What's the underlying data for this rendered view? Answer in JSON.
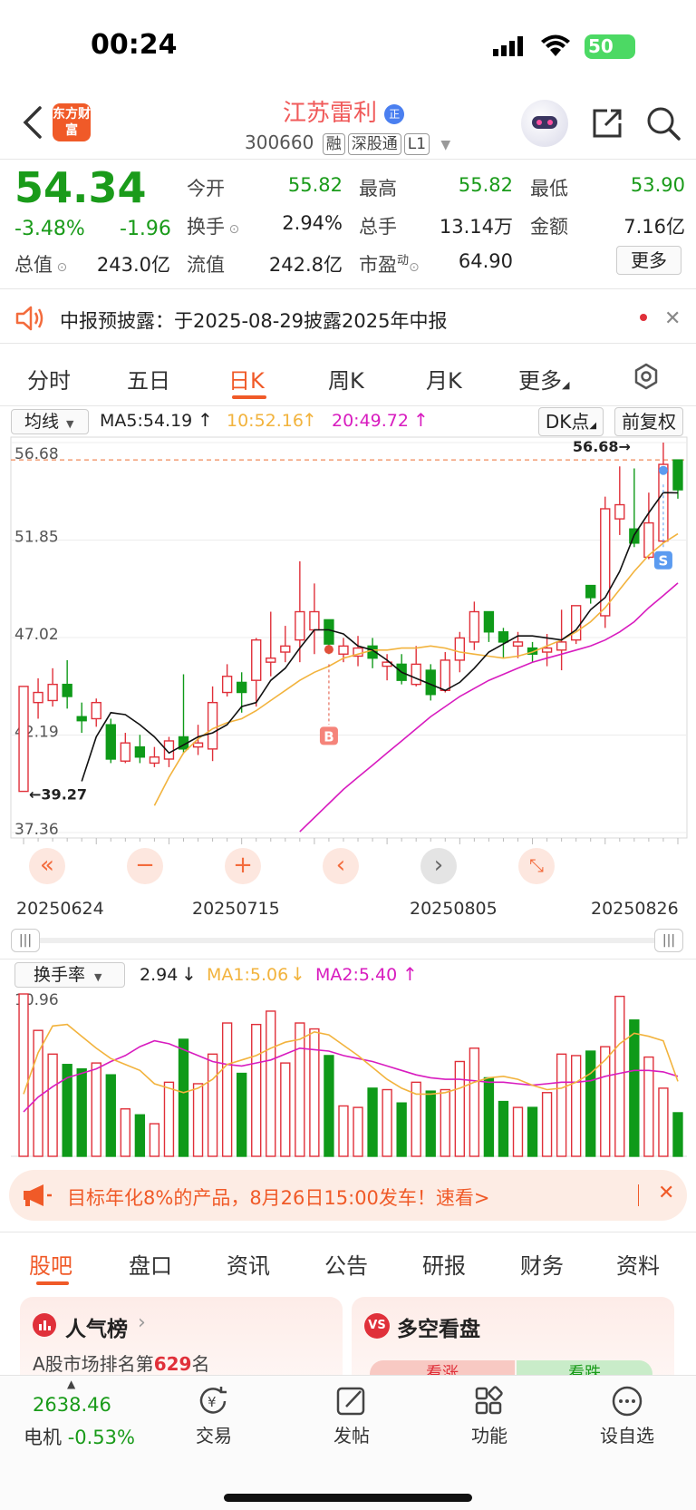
{
  "status_bar": {
    "time": "00:24",
    "battery": "50"
  },
  "header": {
    "logo": "东方财富",
    "title": "江苏雷利",
    "title_badge": "正",
    "code": "300660",
    "badges": [
      "融",
      "深股通",
      "L1"
    ]
  },
  "quote": {
    "price": "54.34",
    "change_pct": "-3.48%",
    "change": "-1.96",
    "rows": [
      [
        {
          "label": "今开",
          "value": "55.82",
          "color": "green"
        },
        {
          "label": "最高",
          "value": "55.82",
          "color": "green"
        },
        {
          "label": "最低",
          "value": "53.90",
          "color": "green"
        }
      ],
      [
        {
          "label": "换手",
          "value": "2.94%",
          "color": "dark"
        },
        {
          "label": "总手",
          "value": "13.14万",
          "color": "dark"
        },
        {
          "label": "金额",
          "value": "7.16亿",
          "color": "dark"
        }
      ]
    ],
    "total_value_label": "总值",
    "total_value": "243.0亿",
    "float_value_label": "流值",
    "float_value": "242.8亿",
    "pe_label": "市盈",
    "pe_sup": "动",
    "pe_value": "64.90",
    "more": "更多"
  },
  "notice": {
    "text": "中报预披露：于2025-08-29披露2025年中报"
  },
  "period_tabs": [
    "分时",
    "五日",
    "日K",
    "周K",
    "月K",
    "更多"
  ],
  "active_tab": 2,
  "kline": {
    "indicator_select": "均线",
    "ma5": "MA5:54.19",
    "ma10": "10:52.16",
    "ma20": "20:49.72",
    "dk": "DK点",
    "fq": "前复权",
    "y_labels": [
      "56.68",
      "51.85",
      "47.02",
      "42.19",
      "37.36"
    ],
    "max_label": "56.68",
    "min_label": "39.27",
    "marker_b": "B",
    "marker_s": "S",
    "dates": [
      "20250624",
      "20250715",
      "20250805",
      "20250826"
    ]
  },
  "volume": {
    "indicator_select": "换手率",
    "value": "2.94",
    "ma1": "MA1:5.06",
    "ma2": "MA2:5.40",
    "max_label": "10.96"
  },
  "chart_data": {
    "type": "candlestick",
    "ylim": [
      37.36,
      56.68
    ],
    "candles": [
      {
        "o": 39.4,
        "c": 44.6,
        "h": 44.6,
        "l": 39.4
      },
      {
        "o": 43.8,
        "c": 44.3,
        "h": 45.0,
        "l": 43.0
      },
      {
        "o": 43.9,
        "c": 44.7,
        "h": 45.5,
        "l": 43.6
      },
      {
        "o": 44.7,
        "c": 44.1,
        "h": 45.9,
        "l": 43.5
      },
      {
        "o": 43.1,
        "c": 42.9,
        "h": 43.8,
        "l": 42.3
      },
      {
        "o": 43.0,
        "c": 43.8,
        "h": 44.0,
        "l": 42.6
      },
      {
        "o": 42.7,
        "c": 41.0,
        "h": 43.0,
        "l": 40.8
      },
      {
        "o": 40.9,
        "c": 41.8,
        "h": 42.3,
        "l": 40.8
      },
      {
        "o": 41.6,
        "c": 41.1,
        "h": 42.2,
        "l": 40.8
      },
      {
        "o": 40.8,
        "c": 41.1,
        "h": 41.6,
        "l": 40.6
      },
      {
        "o": 41.0,
        "c": 41.9,
        "h": 42.1,
        "l": 40.6
      },
      {
        "o": 42.1,
        "c": 41.5,
        "h": 45.2,
        "l": 41.3
      },
      {
        "o": 41.6,
        "c": 41.8,
        "h": 42.7,
        "l": 41.2
      },
      {
        "o": 41.5,
        "c": 43.8,
        "h": 44.6,
        "l": 40.9
      },
      {
        "o": 44.3,
        "c": 45.1,
        "h": 45.7,
        "l": 44.1
      },
      {
        "o": 44.8,
        "c": 44.3,
        "h": 45.3,
        "l": 43.3
      },
      {
        "o": 44.9,
        "c": 46.9,
        "h": 47.0,
        "l": 43.6
      },
      {
        "o": 45.8,
        "c": 46.0,
        "h": 48.3,
        "l": 45.1
      },
      {
        "o": 46.3,
        "c": 46.6,
        "h": 47.6,
        "l": 45.8
      },
      {
        "o": 46.9,
        "c": 48.3,
        "h": 50.8,
        "l": 45.8
      },
      {
        "o": 47.4,
        "c": 48.3,
        "h": 49.7,
        "l": 46.2
      },
      {
        "o": 47.9,
        "c": 46.7,
        "h": 47.9,
        "l": 46.2
      },
      {
        "o": 46.2,
        "c": 46.6,
        "h": 47.0,
        "l": 45.8
      },
      {
        "o": 46.1,
        "c": 46.5,
        "h": 47.1,
        "l": 45.6
      },
      {
        "o": 46.6,
        "c": 46.0,
        "h": 47.0,
        "l": 45.5
      },
      {
        "o": 45.6,
        "c": 45.8,
        "h": 46.2,
        "l": 44.9
      },
      {
        "o": 45.7,
        "c": 44.9,
        "h": 46.2,
        "l": 44.7
      },
      {
        "o": 44.7,
        "c": 45.7,
        "h": 46.6,
        "l": 44.6
      },
      {
        "o": 45.4,
        "c": 44.2,
        "h": 45.7,
        "l": 43.9
      },
      {
        "o": 44.4,
        "c": 45.9,
        "h": 46.3,
        "l": 44.3
      },
      {
        "o": 45.9,
        "c": 47.0,
        "h": 47.3,
        "l": 45.3
      },
      {
        "o": 46.8,
        "c": 48.3,
        "h": 48.8,
        "l": 46.4
      },
      {
        "o": 48.3,
        "c": 47.3,
        "h": 48.3,
        "l": 46.8
      },
      {
        "o": 47.3,
        "c": 46.8,
        "h": 47.5,
        "l": 46.0
      },
      {
        "o": 46.6,
        "c": 46.8,
        "h": 47.3,
        "l": 46.0
      },
      {
        "o": 46.5,
        "c": 46.2,
        "h": 46.8,
        "l": 45.8
      },
      {
        "o": 46.3,
        "c": 46.5,
        "h": 47.2,
        "l": 45.6
      },
      {
        "o": 46.4,
        "c": 46.8,
        "h": 48.4,
        "l": 45.4
      },
      {
        "o": 46.9,
        "c": 48.6,
        "h": 48.6,
        "l": 46.7
      },
      {
        "o": 49.6,
        "c": 49.0,
        "h": 49.6,
        "l": 48.7
      },
      {
        "o": 48.1,
        "c": 53.4,
        "h": 54.0,
        "l": 47.5
      },
      {
        "o": 52.9,
        "c": 53.6,
        "h": 55.5,
        "l": 52.1
      },
      {
        "o": 52.4,
        "c": 51.7,
        "h": 55.4,
        "l": 51.5
      },
      {
        "o": 51.0,
        "c": 52.7,
        "h": 54.2,
        "l": 50.9
      },
      {
        "o": 51.8,
        "c": 55.6,
        "h": 56.68,
        "l": 51.7
      },
      {
        "o": 55.82,
        "c": 54.34,
        "h": 55.82,
        "l": 53.9
      }
    ],
    "ma5": [
      null,
      null,
      null,
      null,
      39.9,
      42.1,
      43.3,
      43.2,
      42.7,
      42.1,
      41.3,
      41.7,
      42.1,
      42.3,
      42.7,
      43.6,
      43.8,
      44.9,
      45.5,
      46.5,
      47.4,
      47.4,
      47.2,
      46.6,
      46.4,
      45.9,
      45.3,
      45.0,
      44.7,
      44.4,
      44.8,
      45.5,
      46.3,
      46.7,
      47.1,
      47.1,
      47.0,
      46.9,
      47.4,
      48.4,
      49.0,
      50.3,
      52.1,
      53.2,
      54.2,
      54.19
    ],
    "ma10": [
      null,
      null,
      null,
      null,
      null,
      null,
      null,
      null,
      null,
      38.7,
      40.1,
      41.3,
      42.0,
      42.5,
      42.8,
      43.0,
      43.4,
      43.9,
      44.4,
      44.9,
      45.3,
      45.6,
      46.0,
      46.2,
      46.4,
      46.4,
      46.5,
      46.5,
      46.6,
      46.5,
      46.3,
      46.2,
      46.1,
      46.0,
      46.1,
      46.3,
      46.6,
      46.9,
      47.3,
      47.8,
      48.5,
      49.4,
      50.3,
      51.1,
      51.7,
      52.16
    ],
    "ma20": [
      null,
      null,
      null,
      null,
      null,
      null,
      null,
      null,
      null,
      null,
      null,
      null,
      null,
      null,
      null,
      null,
      null,
      null,
      null,
      37.4,
      38.1,
      38.8,
      39.5,
      40.1,
      40.7,
      41.3,
      41.9,
      42.5,
      43.1,
      43.6,
      44.1,
      44.5,
      44.9,
      45.2,
      45.5,
      45.8,
      46.0,
      46.2,
      46.4,
      46.6,
      46.9,
      47.3,
      47.8,
      48.5,
      49.1,
      49.72
    ],
    "turnover": [
      10.96,
      8.5,
      6.9,
      6.2,
      5.9,
      6.3,
      5.5,
      3.2,
      2.8,
      2.2,
      5.0,
      7.9,
      4.9,
      6.9,
      9.0,
      5.6,
      8.9,
      9.8,
      6.3,
      9.0,
      8.6,
      6.8,
      3.4,
      3.3,
      4.6,
      4.5,
      3.6,
      5.0,
      4.4,
      4.5,
      6.4,
      7.3,
      5.3,
      3.7,
      3.3,
      3.3,
      4.3,
      6.9,
      6.8,
      7.1,
      7.4,
      10.8,
      9.2,
      6.7,
      4.6,
      2.94
    ],
    "turnover_ma1": [
      4.2,
      7.0,
      8.8,
      8.9,
      8.1,
      7.3,
      6.6,
      6.2,
      5.8,
      4.9,
      4.6,
      4.3,
      4.6,
      5.2,
      6.2,
      6.5,
      6.8,
      7.3,
      7.7,
      7.9,
      8.4,
      8.2,
      7.5,
      6.8,
      6.0,
      5.2,
      4.6,
      4.2,
      4.2,
      4.3,
      4.6,
      5.0,
      5.3,
      5.4,
      5.2,
      4.8,
      4.5,
      4.6,
      5.0,
      5.6,
      6.5,
      7.6,
      8.3,
      8.1,
      7.8,
      5.06
    ],
    "turnover_ma2": [
      3.0,
      4.0,
      4.7,
      5.3,
      5.6,
      5.9,
      6.4,
      6.8,
      7.4,
      7.8,
      7.6,
      7.2,
      6.8,
      6.4,
      6.2,
      6.1,
      6.3,
      6.5,
      6.9,
      7.3,
      7.2,
      7.1,
      6.8,
      6.6,
      6.4,
      6.1,
      5.8,
      5.5,
      5.3,
      5.2,
      5.2,
      5.1,
      5.0,
      5.0,
      4.9,
      4.8,
      4.9,
      5.0,
      5.0,
      5.1,
      5.4,
      5.6,
      5.8,
      5.8,
      5.7,
      5.4
    ]
  },
  "promo": {
    "text": "目标年化8%的产品，8月26日15:00发车！速看>"
  },
  "section_tabs": [
    "股吧",
    "盘口",
    "资讯",
    "公告",
    "研报",
    "财务",
    "资料"
  ],
  "cards": [
    {
      "title": "人气榜",
      "subtitle_prefix": "A股市场排名第",
      "rank": "629",
      "subtitle_suffix": "名"
    },
    {
      "title": "多空看盘",
      "left": "看涨",
      "right": "看跌"
    }
  ],
  "bottom_nav": {
    "index_value": "2638.46",
    "index_name": "电机",
    "index_change": "-0.53%",
    "items": [
      "交易",
      "发帖",
      "功能",
      "设自选"
    ]
  }
}
